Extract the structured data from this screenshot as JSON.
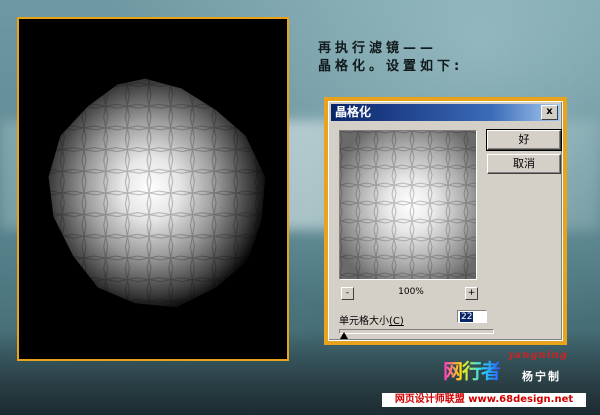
{
  "caption": {
    "line1": "再执行滤镜——",
    "line2": "晶格化。设置如下:"
  },
  "dialog": {
    "title": "晶格化",
    "close_label": "x",
    "ok_label": "好",
    "cancel_label": "取消",
    "zoom_minus": "-",
    "zoom_plus": "+",
    "zoom_value": "100%",
    "cell_size_label": "单元格大小",
    "cell_size_hotkey": "(C)",
    "cell_size_value": "22",
    "cell_size_slider_fraction": 0.03
  },
  "branding": {
    "logo_text": "网行者",
    "signature_en": "yangning",
    "signature_cn": "杨宁制",
    "footer_text": "网页设计师联盟 www.68design.net"
  },
  "colors": {
    "frame_accent": "#e9a21b",
    "titlebar": "#0a246a",
    "footer_text": "#d10000"
  }
}
